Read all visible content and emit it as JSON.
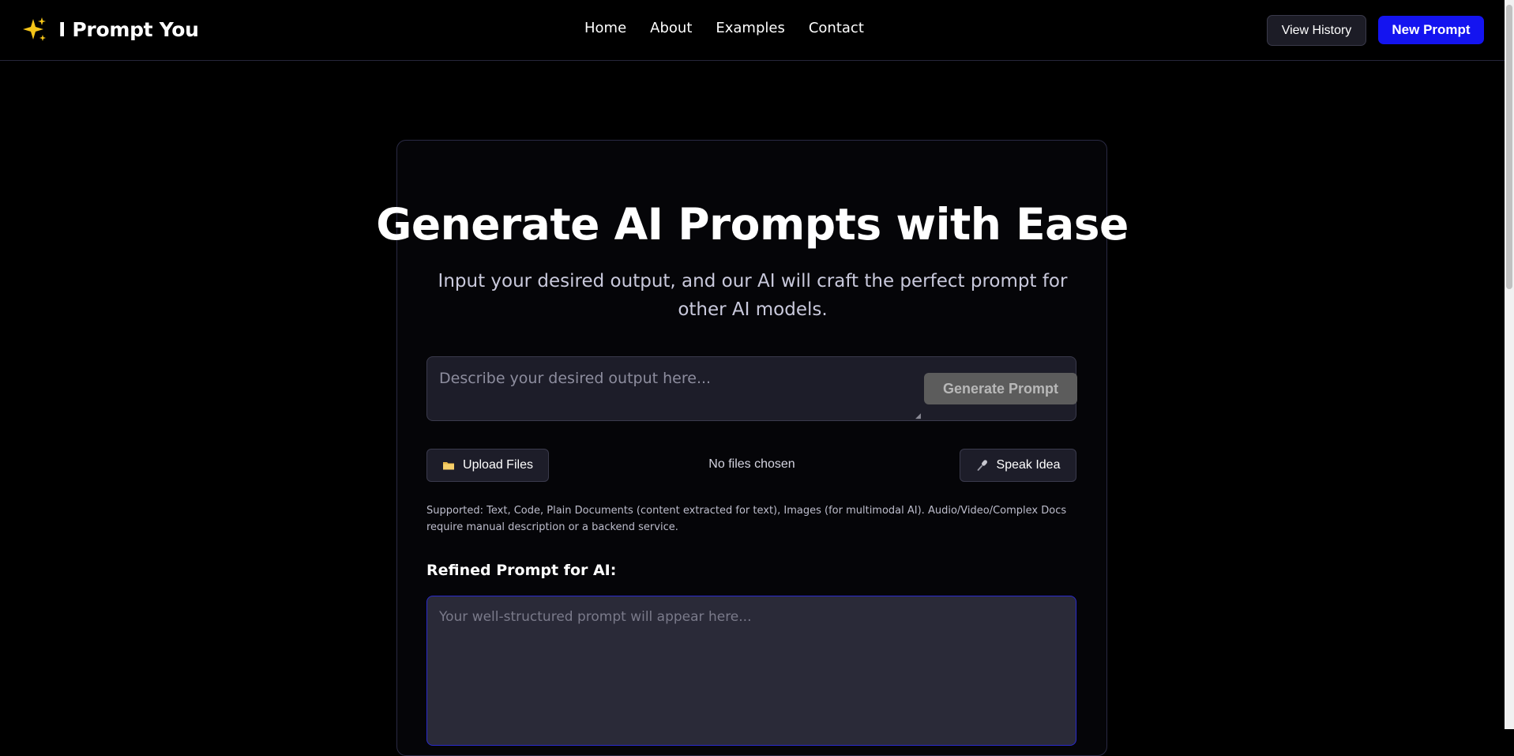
{
  "header": {
    "brand_name": "I Prompt You",
    "brand_icon": "sparkles-icon",
    "nav": [
      "Home",
      "About",
      "Examples",
      "Contact"
    ],
    "view_history_label": "View History",
    "new_prompt_label": "New Prompt"
  },
  "hero": {
    "title": "Generate AI Prompts with Ease",
    "subtitle": "Input your desired output, and our AI will craft the perfect prompt for other AI models."
  },
  "input": {
    "placeholder": "Describe your desired output here...",
    "value": "",
    "generate_label": "Generate Prompt"
  },
  "files": {
    "upload_label": "Upload Files",
    "upload_icon": "folder-icon",
    "status_text": "No files chosen",
    "speak_label": "Speak Idea",
    "speak_icon": "microphone-icon"
  },
  "supported_note": "Supported: Text, Code, Plain Documents (content extracted for text), Images (for multimodal AI). Audio/Video/Complex Docs require manual description or a backend service.",
  "output": {
    "label": "Refined Prompt for AI:",
    "placeholder": "Your well-structured prompt will appear here...",
    "value": ""
  },
  "colors": {
    "background": "#000000",
    "accent": "#1414f0",
    "panel": "#1d1d29",
    "disabled_button": "#5c5c5c"
  }
}
